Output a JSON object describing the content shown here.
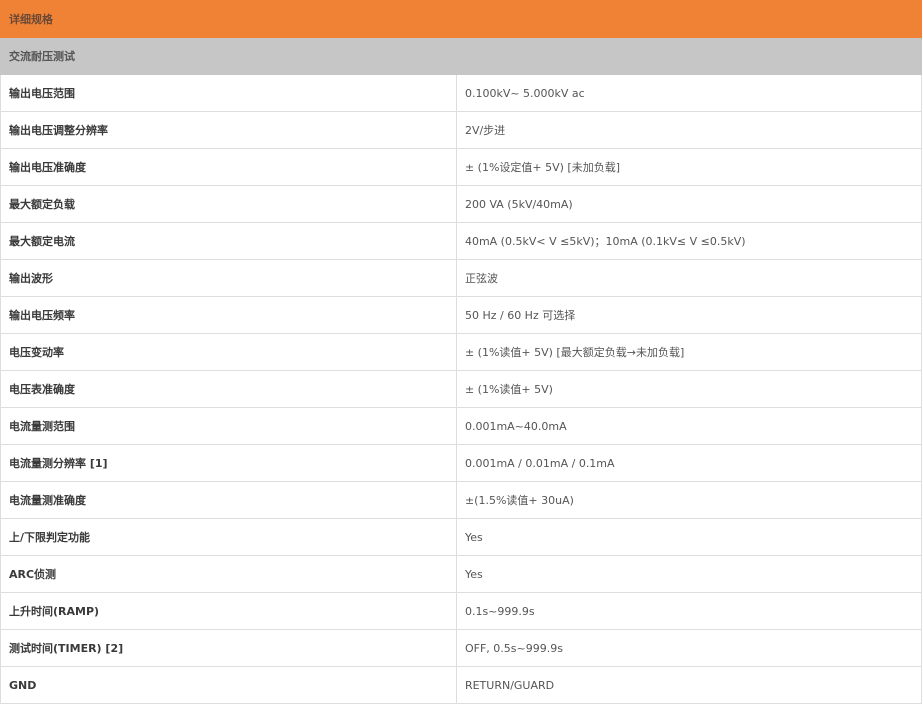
{
  "header": {
    "title": "详细规格",
    "section": "交流耐压测试"
  },
  "colors": {
    "title_bar": "#f08236",
    "section_bar": "#c6c6c6"
  },
  "rows": [
    {
      "label": "输出电压范围",
      "value": "0.100kV~ 5.000kV ac"
    },
    {
      "label": "输出电压调整分辨率",
      "value": "2V/步进"
    },
    {
      "label": "输出电压准确度",
      "value": "± (1%设定值+ 5V) [未加负载]"
    },
    {
      "label": "最大额定负载",
      "value": "200 VA (5kV/40mA)"
    },
    {
      "label": "最大额定电流",
      "value": "40mA (0.5kV< V ≤5kV)；10mA (0.1kV≤ V ≤0.5kV)"
    },
    {
      "label": "输出波形",
      "value": "正弦波"
    },
    {
      "label": "输出电压频率",
      "value": "50 Hz / 60 Hz 可选择"
    },
    {
      "label": "电压变动率",
      "value": "± (1%读值+ 5V) [最大额定负载→未加负载]"
    },
    {
      "label": "电压表准确度",
      "value": "± (1%读值+ 5V)"
    },
    {
      "label": "电流量测范围",
      "value": "0.001mA~40.0mA"
    },
    {
      "label": "电流量测分辨率 [1]",
      "value": "0.001mA / 0.01mA / 0.1mA"
    },
    {
      "label": "电流量测准确度",
      "value": "±(1.5%读值+ 30uA)"
    },
    {
      "label": "上/下限判定功能",
      "value": "Yes"
    },
    {
      "label": "ARC侦测",
      "value": "Yes"
    },
    {
      "label": "上升时间(RAMP)",
      "value": "0.1s~999.9s"
    },
    {
      "label": "测试时间(TIMER) [2]",
      "value": "OFF, 0.5s~999.9s"
    },
    {
      "label": "GND",
      "value": "RETURN/GUARD"
    }
  ]
}
